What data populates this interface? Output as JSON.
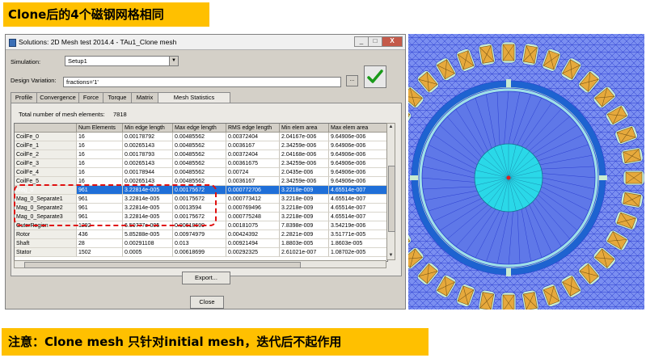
{
  "banners": {
    "top": "Clone后的4个磁钢网格相同",
    "bottom": "注意：Clone mesh 只针对initial mesh，迭代后不起作用"
  },
  "window": {
    "title": "Solutions: 2D Mesh test 2014.4 - TAu1_Clone mesh",
    "minimize": "_",
    "maximize": "□",
    "close": "X"
  },
  "simulation": {
    "label": "Simulation:",
    "value": "Setup1"
  },
  "design_variation": {
    "label": "Design Variation:",
    "value": "fractions='1'",
    "browse": "..."
  },
  "tabs": [
    "Profile",
    "Convergence",
    "Force",
    "Torque",
    "Matrix",
    "Mesh Statistics"
  ],
  "active_tab": "Mesh Statistics",
  "total_elements": {
    "label": "Total number of mesh elements:",
    "value": "7818"
  },
  "table": {
    "columns": [
      "",
      "Num Elements",
      "Min edge length",
      "Max edge length",
      "RMS edge length",
      "Min elem area",
      "Max elem area"
    ],
    "rows": [
      [
        "CoilFe_0",
        "16",
        "0.00178792",
        "0.00485562",
        "0.00372404",
        "2.04167e-006",
        "9.64906e-006"
      ],
      [
        "CoilFe_1",
        "16",
        "0.00265143",
        "0.00485562",
        "0.0036167",
        "2.34259e-006",
        "9.64906e-006"
      ],
      [
        "CoilFe_2",
        "16",
        "0.00178793",
        "0.00485562",
        "0.00372404",
        "2.04168e-006",
        "9.64906e-006"
      ],
      [
        "CoilFe_3",
        "16",
        "0.00265143",
        "0.00485562",
        "0.00361675",
        "2.34259e-006",
        "9.64906e-006"
      ],
      [
        "CoilFe_4",
        "16",
        "0.00178944",
        "0.00485562",
        "0.00724",
        "2.0435e-006",
        "9.64906e-006"
      ],
      [
        "CoilFe_5",
        "16",
        "0.00265143",
        "0.00485562",
        "0.0036167",
        "2.34259e-006",
        "9.64906e-006"
      ],
      [
        "Mag_0",
        "961",
        "3.22814e-005",
        "0.00175672",
        "0.000772706",
        "3.2218e-009",
        "4.65514e-007"
      ],
      [
        "Mag_0_Separate1",
        "961",
        "3.22814e-005",
        "0.00175672",
        "0.000773412",
        "3.2218e-009",
        "4.65514e-007"
      ],
      [
        "Mag_0_Separate2",
        "961",
        "3.22814e-005",
        "0.0013594",
        "0.000769496",
        "3.2218e-009",
        "4.65514e-007"
      ],
      [
        "Mag_0_Separate3",
        "961",
        "3.22814e-005",
        "0.00175672",
        "0.000775248",
        "3.2218e-009",
        "4.65514e-007"
      ],
      [
        "OuterRegion",
        "1292",
        "6.50777e-005",
        "0.00618699",
        "0.00181075",
        "7.8398e-009",
        "3.54219e-006"
      ],
      [
        "Rotor",
        "436",
        "5.85288e-005",
        "0.00974979",
        "0.00424392",
        "2.2821e-009",
        "3.51771e-005"
      ],
      [
        "Shaft",
        "28",
        "0.00291108",
        "0.013",
        "0.00921494",
        "1.8803e-005",
        "1.8603e-005"
      ],
      [
        "Stator",
        "1502",
        "0.0005",
        "0.00618699",
        "0.00292325",
        "2.61021e-007",
        "1.08702e-005"
      ]
    ],
    "selected_row": 6
  },
  "buttons": {
    "export": "Export...",
    "close": "Close"
  },
  "colors": {
    "banner": "#ffc000",
    "selection": "#1f6fd8",
    "annotation_box": "#e01010",
    "stator_mesh": "#3a52d8",
    "rotor": "#2ad8e8",
    "coil": "#e6a93c"
  },
  "icons": {
    "apply": "green-check-icon"
  }
}
